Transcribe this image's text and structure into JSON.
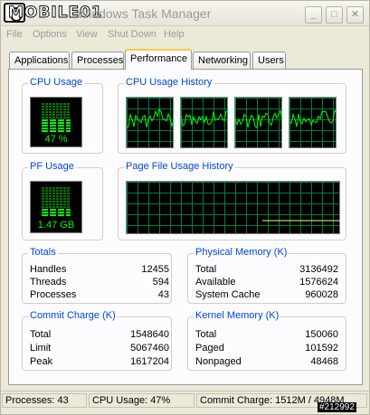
{
  "window": {
    "title": "Windows Task Manager",
    "watermark": "MOBILE01",
    "controls": {
      "minimize": "_",
      "maximize": "□",
      "close": "✕"
    }
  },
  "menu": [
    "File",
    "Options",
    "View",
    "Shut Down",
    "Help"
  ],
  "tabs": [
    "Applications",
    "Processes",
    "Performance",
    "Networking",
    "Users"
  ],
  "active_tab": "Performance",
  "cpu_usage": {
    "label": "CPU Usage",
    "value": "47 %",
    "fraction": 0.47
  },
  "cpu_history": {
    "label": "CPU Usage History"
  },
  "pf_usage": {
    "label": "PF Usage",
    "value": "1.47 GB",
    "fraction": 0.3
  },
  "pf_history": {
    "label": "Page File Usage History"
  },
  "totals": {
    "label": "Totals",
    "rows": [
      {
        "k": "Handles",
        "v": "12455"
      },
      {
        "k": "Threads",
        "v": "594"
      },
      {
        "k": "Processes",
        "v": "43"
      }
    ]
  },
  "physical_memory": {
    "label": "Physical Memory (K)",
    "rows": [
      {
        "k": "Total",
        "v": "3136492"
      },
      {
        "k": "Available",
        "v": "1576624"
      },
      {
        "k": "System Cache",
        "v": "960028"
      }
    ]
  },
  "commit_charge": {
    "label": "Commit Charge (K)",
    "rows": [
      {
        "k": "Total",
        "v": "1548640"
      },
      {
        "k": "Limit",
        "v": "5067460"
      },
      {
        "k": "Peak",
        "v": "1617204"
      }
    ]
  },
  "kernel_memory": {
    "label": "Kernel Memory (K)",
    "rows": [
      {
        "k": "Total",
        "v": "150060"
      },
      {
        "k": "Paged",
        "v": "101592"
      },
      {
        "k": "Nonpaged",
        "v": "48468"
      }
    ]
  },
  "status": {
    "processes": "Processes: 43",
    "cpu": "CPU Usage: 47%",
    "commit": "Commit Charge: 1512M / 4948M"
  },
  "image_tag": "#212992",
  "colors": {
    "meter_green": "#00ff00",
    "grid_green": "#008040",
    "label_blue": "#0046d5",
    "tab_highlight": "#ffc83c"
  }
}
